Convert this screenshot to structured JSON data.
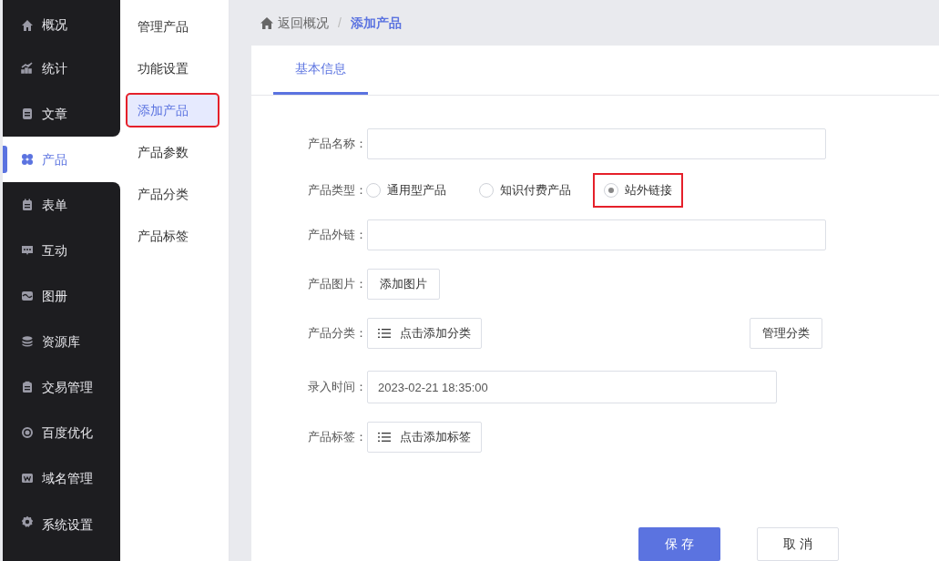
{
  "sidebar": {
    "items": [
      {
        "label": "概况",
        "selected": false
      },
      {
        "label": "统计",
        "selected": false
      },
      {
        "label": "文章",
        "selected": false
      },
      {
        "label": "产品",
        "selected": true
      },
      {
        "label": "表单",
        "selected": false
      },
      {
        "label": "互动",
        "selected": false
      },
      {
        "label": "图册",
        "selected": false
      },
      {
        "label": "资源库",
        "selected": false
      },
      {
        "label": "交易管理",
        "selected": false
      },
      {
        "label": "百度优化",
        "selected": false
      },
      {
        "label": "域名管理",
        "selected": false
      },
      {
        "label": "系统设置",
        "selected": false
      }
    ]
  },
  "submenu": {
    "items": [
      {
        "label": "管理产品",
        "selected": false,
        "highlighted": false
      },
      {
        "label": "功能设置",
        "selected": false,
        "highlighted": false
      },
      {
        "label": "添加产品",
        "selected": true,
        "highlighted": true
      },
      {
        "label": "产品参数",
        "selected": false,
        "highlighted": false
      },
      {
        "label": "产品分类",
        "selected": false,
        "highlighted": false
      },
      {
        "label": "产品标签",
        "selected": false,
        "highlighted": false
      }
    ]
  },
  "breadcrumb": {
    "back": "返回概况",
    "separator": "/",
    "current": "添加产品"
  },
  "tabs": [
    {
      "label": "基本信息",
      "selected": true
    }
  ],
  "form": {
    "fields": [
      {
        "kind": "text",
        "label": "产品名称："
      },
      {
        "kind": "radio",
        "label": "产品类型：",
        "options": [
          {
            "label": "通用型产品",
            "selected": false,
            "highlighted": false
          },
          {
            "label": "知识付费产品",
            "selected": false,
            "highlighted": false
          },
          {
            "label": "站外链接",
            "selected": true,
            "highlighted": true
          }
        ]
      },
      {
        "kind": "text",
        "label": "产品外链："
      },
      {
        "kind": "button",
        "label": "产品图片：",
        "button": "添加图片"
      },
      {
        "kind": "picker",
        "label": "产品分类：",
        "button": "点击添加分类",
        "side_button": "管理分类"
      },
      {
        "kind": "date",
        "label": "录入时间：",
        "value": "2023-02-21 18:35:00"
      },
      {
        "kind": "picker",
        "label": "产品标签：",
        "button": "点击添加标签"
      }
    ]
  },
  "actions": {
    "save": "保 存",
    "cancel": "取 消"
  }
}
